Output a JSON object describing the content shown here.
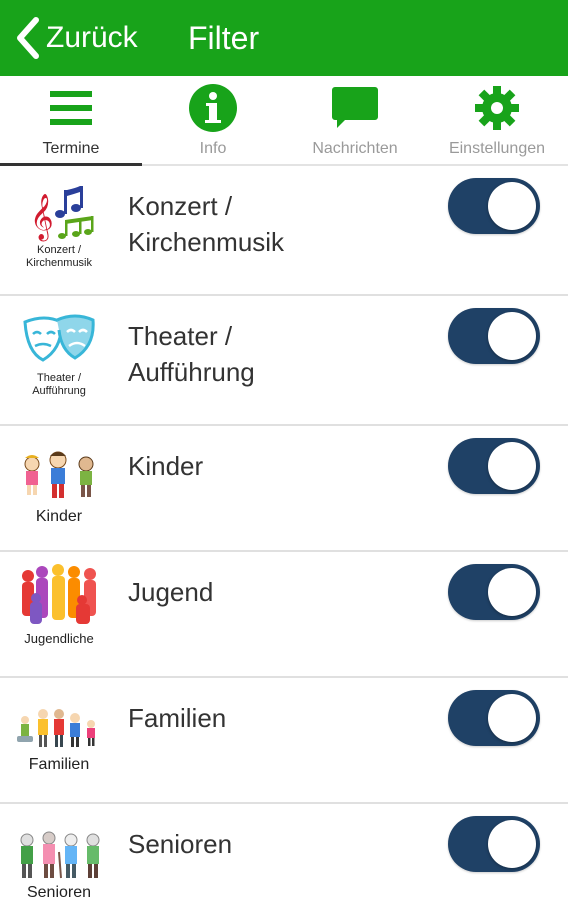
{
  "header": {
    "back_label": "Zurück",
    "title": "Filter",
    "accent": "#18a31a"
  },
  "tabs": [
    {
      "label": "Termine",
      "icon": "menu-icon",
      "active": true
    },
    {
      "label": "Info",
      "icon": "info-icon"
    },
    {
      "label": "Nachrichten",
      "icon": "chat-bubble-icon"
    },
    {
      "label": "Einstellungen",
      "icon": "gear-icon"
    }
  ],
  "categories": [
    {
      "label_line1": "Konzert /",
      "label_line2": "Kirchenmusik",
      "thumb_caption_line1": "Konzert /",
      "thumb_caption_line2": "Kirchenmusik",
      "enabled": true
    },
    {
      "label_line1": "Theater /",
      "label_line2": "Aufführung",
      "thumb_caption_line1": "Theater /",
      "thumb_caption_line2": "Aufführung",
      "enabled": true
    },
    {
      "label_line1": "Kinder",
      "label_line2": "",
      "thumb_caption_line1": "Kinder",
      "thumb_caption_line2": "",
      "enabled": true
    },
    {
      "label_line1": "Jugend",
      "label_line2": "",
      "thumb_caption_line1": "Jugendliche",
      "thumb_caption_line2": "",
      "enabled": true
    },
    {
      "label_line1": "Familien",
      "label_line2": "",
      "thumb_caption_line1": "Familien",
      "thumb_caption_line2": "",
      "enabled": true
    },
    {
      "label_line1": "Senioren",
      "label_line2": "",
      "thumb_caption_line1": "Senioren",
      "thumb_caption_line2": "",
      "enabled": true
    }
  ],
  "colors": {
    "toggle_on": "#1f4166",
    "tab_icon": "#18a31a"
  }
}
